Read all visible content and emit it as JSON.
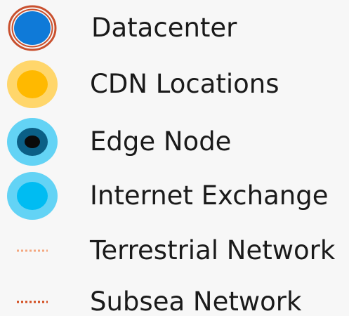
{
  "legend": {
    "items": [
      {
        "label": "Datacenter",
        "icon": "datacenter-marker",
        "fill": "#0f7ad8",
        "stroke": "#c9502e"
      },
      {
        "label": "CDN Locations",
        "icon": "cdn-marker",
        "fill": "#ffb900",
        "halo": "#ffd66b"
      },
      {
        "label": "Edge Node",
        "icon": "edge-node-marker",
        "fill": "#0a0a0a",
        "ring": "#0b5f86",
        "halo": "#63d3f5"
      },
      {
        "label": "Internet Exchange",
        "icon": "internet-exchange-marker",
        "fill": "#00bcf2",
        "halo": "#63d3f5"
      },
      {
        "label": "Terrestrial Network",
        "icon": "dotted-line-light",
        "color": "#f4a77f"
      },
      {
        "label": "Subsea Network",
        "icon": "dotted-line-dark",
        "color": "#d24a1c"
      }
    ]
  }
}
